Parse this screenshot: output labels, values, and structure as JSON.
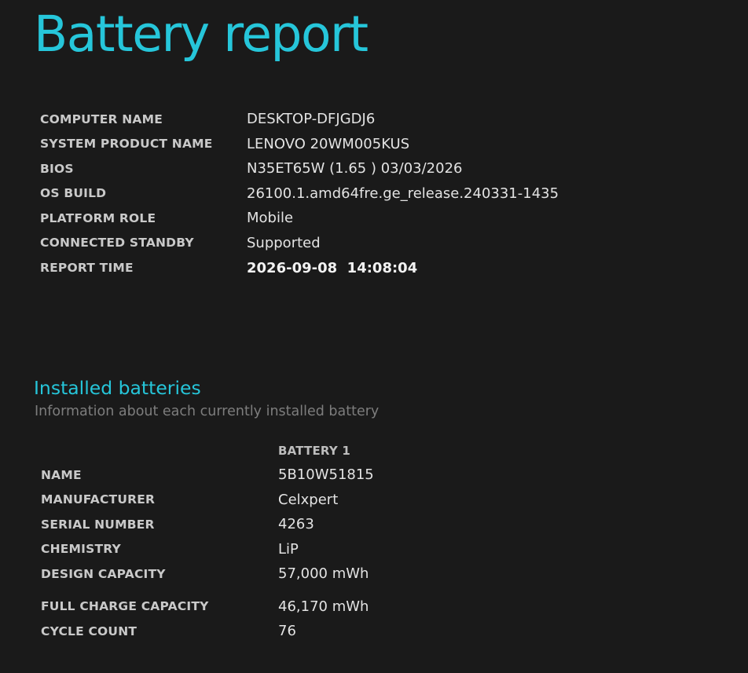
{
  "report": {
    "title": "Battery report"
  },
  "system_info": [
    {
      "label": "COMPUTER NAME",
      "value": "DESKTOP-DFJGDJ6"
    },
    {
      "label": "SYSTEM PRODUCT NAME",
      "value": "LENOVO 20WM005KUS"
    },
    {
      "label": "BIOS",
      "value": "N35ET65W (1.65 ) 03/03/2026"
    },
    {
      "label": "OS BUILD",
      "value": "26100.1.amd64fre.ge_release.240331-1435"
    },
    {
      "label": "PLATFORM ROLE",
      "value": "Mobile"
    },
    {
      "label": "CONNECTED STANDBY",
      "value": "Supported"
    },
    {
      "label": "REPORT TIME",
      "value": "2026-09-08  14:08:04"
    }
  ],
  "installed_batteries": {
    "title": "Installed batteries",
    "subtitle": "Information about each currently installed battery",
    "column_header": "BATTERY 1",
    "rows": [
      {
        "label": "NAME",
        "value": "5B10W51815"
      },
      {
        "label": "MANUFACTURER",
        "value": "Celxpert"
      },
      {
        "label": "SERIAL NUMBER",
        "value": "4263"
      },
      {
        "label": "CHEMISTRY",
        "value": "LiP"
      },
      {
        "label": "DESIGN CAPACITY",
        "value": "57,000 mWh"
      },
      {
        "label": "FULL CHARGE CAPACITY",
        "value": "46,170 mWh"
      },
      {
        "label": "CYCLE COUNT",
        "value": "76"
      }
    ]
  },
  "colors": {
    "background": "#1a1a1a",
    "accent": "#26c6da",
    "label_text": "#c9c9c9",
    "value_text": "#e3e3e3",
    "muted_text": "#7d7d7d"
  }
}
